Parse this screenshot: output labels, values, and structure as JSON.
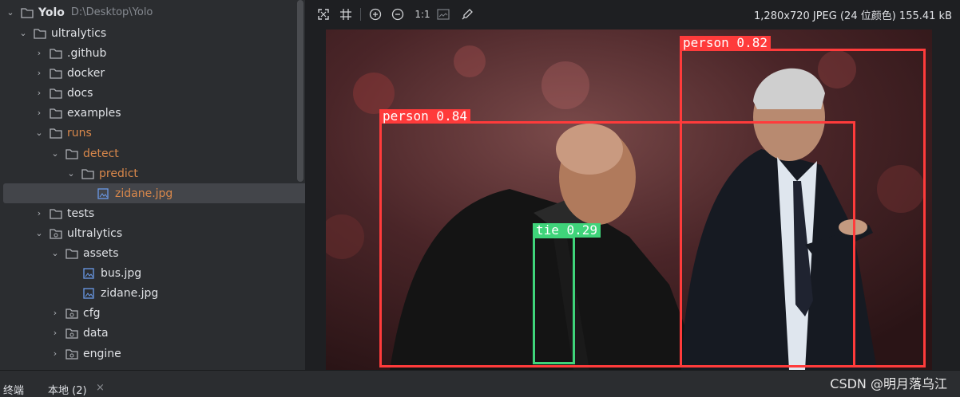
{
  "project_tree": {
    "root": {
      "name": "Yolo",
      "path": "D:\\Desktop\\Yolo"
    },
    "items": [
      {
        "label": "ultralytics",
        "icon": "folder-icon",
        "expanded": true,
        "color": "#dfe1e5"
      },
      {
        "label": ".github",
        "icon": "folder-icon",
        "expanded": false,
        "color": "#dfe1e5"
      },
      {
        "label": "docker",
        "icon": "folder-icon",
        "expanded": false,
        "color": "#dfe1e5"
      },
      {
        "label": "docs",
        "icon": "folder-icon",
        "expanded": false,
        "color": "#dfe1e5"
      },
      {
        "label": "examples",
        "icon": "folder-icon",
        "expanded": false,
        "color": "#dfe1e5"
      },
      {
        "label": "runs",
        "icon": "folder-icon",
        "expanded": true,
        "color": "#d9884b"
      },
      {
        "label": "detect",
        "icon": "folder-icon",
        "expanded": true,
        "color": "#d9884b"
      },
      {
        "label": "predict",
        "icon": "folder-icon",
        "expanded": true,
        "color": "#d9884b"
      },
      {
        "label": "zidane.jpg",
        "icon": "image-file-icon",
        "selected": true,
        "color": "#d9884b"
      },
      {
        "label": "tests",
        "icon": "folder-icon",
        "expanded": false,
        "color": "#dfe1e5"
      },
      {
        "label": "ultralytics",
        "icon": "package-folder-icon",
        "expanded": true,
        "color": "#dfe1e5"
      },
      {
        "label": "assets",
        "icon": "folder-icon",
        "expanded": true,
        "color": "#dfe1e5"
      },
      {
        "label": "bus.jpg",
        "icon": "image-file-icon",
        "color": "#dfe1e5"
      },
      {
        "label": "zidane.jpg",
        "icon": "image-file-icon",
        "color": "#dfe1e5"
      },
      {
        "label": "cfg",
        "icon": "package-folder-icon",
        "expanded": false,
        "color": "#dfe1e5"
      },
      {
        "label": "data",
        "icon": "package-folder-icon",
        "expanded": false,
        "color": "#dfe1e5"
      },
      {
        "label": "engine",
        "icon": "package-folder-icon",
        "expanded": false,
        "color": "#dfe1e5"
      }
    ]
  },
  "viewer": {
    "toolbar": {
      "icons": [
        "fit-screen-icon",
        "grid-icon",
        "zoom-in-icon",
        "zoom-out-icon",
        "actual-size-icon",
        "background-icon",
        "color-picker-icon"
      ],
      "actual_size_label": "1:1"
    },
    "image_info": "1,280x720 JPEG (24 位颜色) 155.41 kB",
    "detections": [
      {
        "label": "person 0.82",
        "class": "person"
      },
      {
        "label": "person 0.84",
        "class": "person"
      },
      {
        "label": "tie 0.29",
        "class": "tie"
      }
    ]
  },
  "bottom_bar": {
    "tabs": [
      "终端",
      "本地 (2)"
    ],
    "close_symbol": "×"
  },
  "watermark": "CSDN @明月落乌江",
  "colors": {
    "person_box": "#ff3b3b",
    "tie_box": "#3fd47a",
    "highlight": "#d9884b"
  }
}
